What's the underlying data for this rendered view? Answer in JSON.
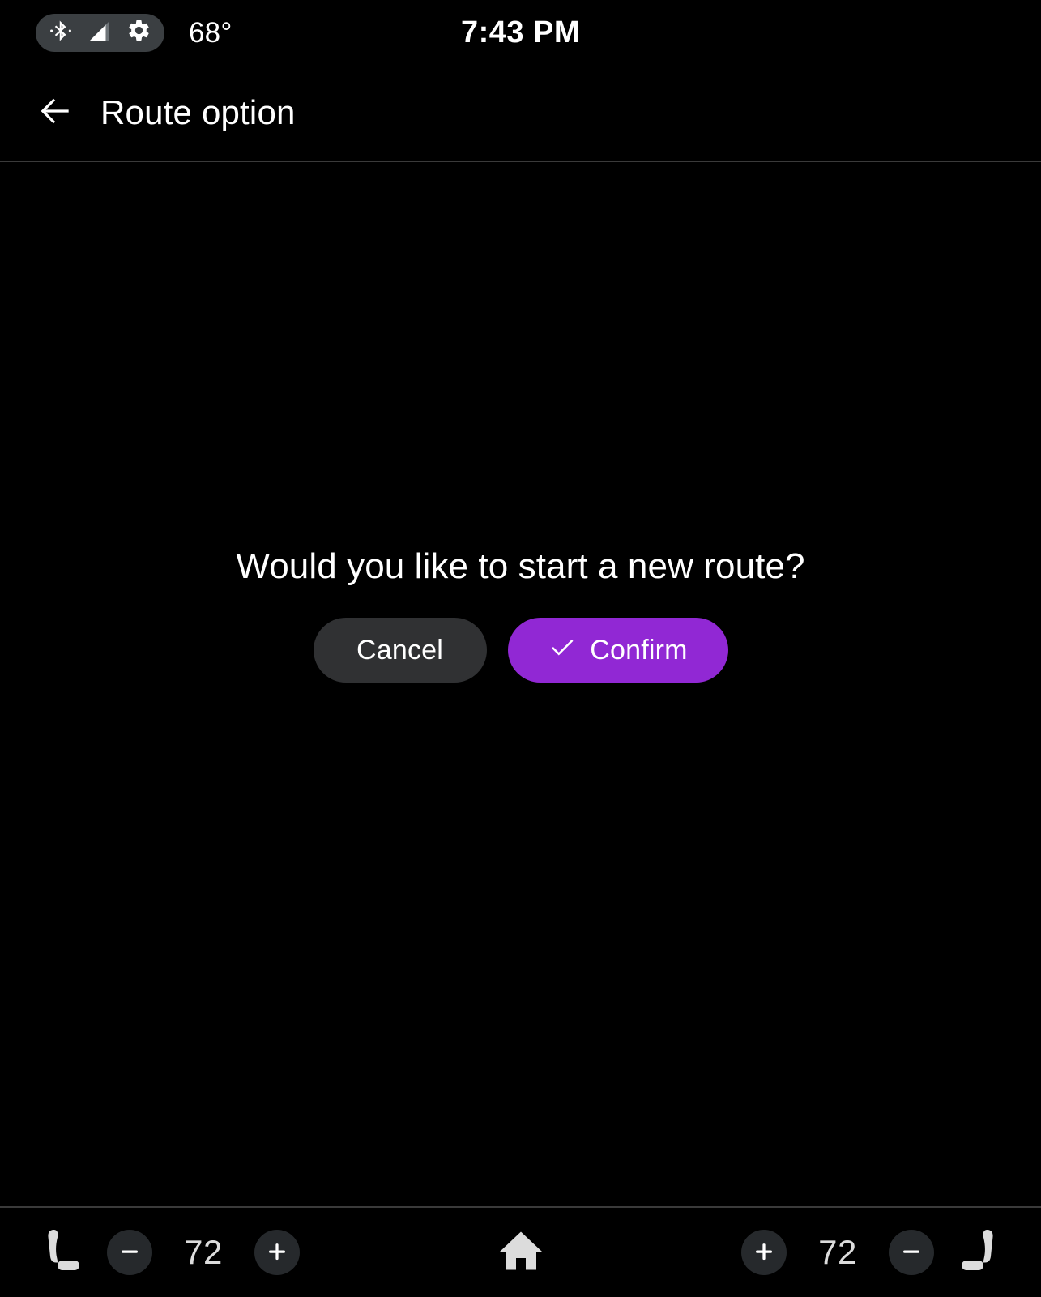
{
  "status_bar": {
    "icons": [
      {
        "name": "bluetooth-icon",
        "label": "Bluetooth"
      },
      {
        "name": "signal-cellular-icon",
        "label": "Cellular signal"
      },
      {
        "name": "gear-icon",
        "label": "Settings"
      }
    ],
    "temperature": "68°",
    "time": "7:43 PM",
    "pill_color": "#3b3f42"
  },
  "header": {
    "back_icon": "arrow-back-icon",
    "title": "Route option"
  },
  "dialog": {
    "message": "Would you like to start a new route?",
    "cancel_label": "Cancel",
    "confirm_label": "Confirm",
    "confirm_icon": "check-icon",
    "cancel_color": "#303133",
    "confirm_color": "#9128d4"
  },
  "bottom_bar": {
    "left_climate": {
      "seat_icon": "seat-icon",
      "decrease_label": "−",
      "temperature": "72",
      "increase_label": "+"
    },
    "home_icon": "home-icon",
    "right_climate": {
      "increase_label": "+",
      "temperature": "72",
      "decrease_label": "−",
      "seat_icon": "seat-icon"
    },
    "button_color": "#26292c",
    "icon_color": "#dcdcdc"
  }
}
